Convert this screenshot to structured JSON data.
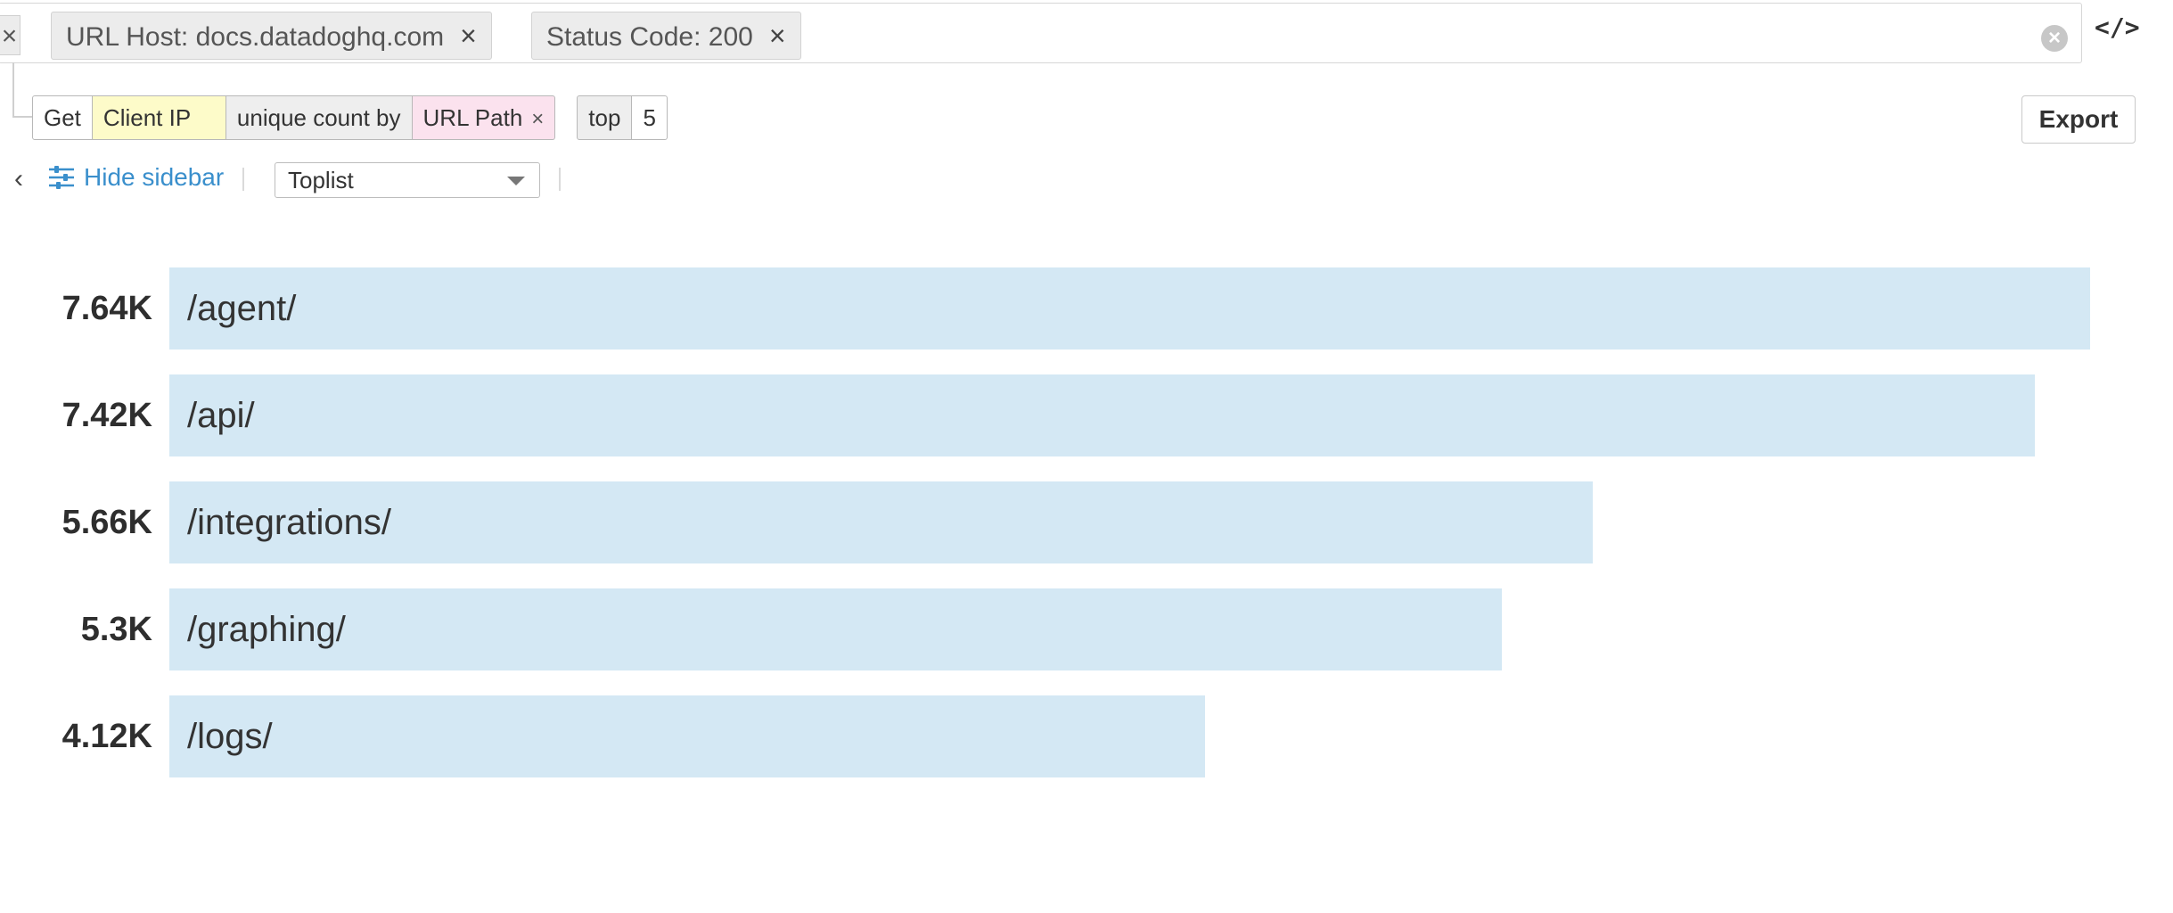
{
  "filters": {
    "left_remove_glyph": "×",
    "pills": [
      {
        "label": "URL Host: docs.datadoghq.com",
        "remove": "×"
      },
      {
        "label": "Status Code: 200",
        "remove": "×"
      }
    ],
    "clear_glyph": "×",
    "code_toggle": "</>"
  },
  "query": {
    "get": "Get",
    "field": "Client IP",
    "aggregation": "unique count by",
    "group_by": "URL Path",
    "group_remove": "×",
    "top_label": "top",
    "top_limit": "5"
  },
  "toolbar": {
    "export_label": "Export",
    "collapse_glyph": "‹",
    "hide_sidebar_label": "Hide sidebar",
    "visualization": "Toplist"
  },
  "chart_data": {
    "type": "bar",
    "orientation": "horizontal",
    "categories": [
      "/agent/",
      "/api/",
      "/integrations/",
      "/graphing/",
      "/logs/"
    ],
    "values": [
      7640,
      7420,
      5660,
      5300,
      4120
    ],
    "value_labels": [
      "7.64K",
      "7.42K",
      "5.66K",
      "5.3K",
      "4.12K"
    ],
    "bar_color": "#d4e8f4"
  },
  "colors": {
    "accent": "#3a8fcc",
    "field_highlight": "#fdfbc9",
    "group_highlight": "#fbe2ee"
  },
  "icons": {
    "sidebar": "sliders-icon",
    "select": "caret-down-icon",
    "clear": "clear-circle-icon",
    "code": "code-icon"
  }
}
